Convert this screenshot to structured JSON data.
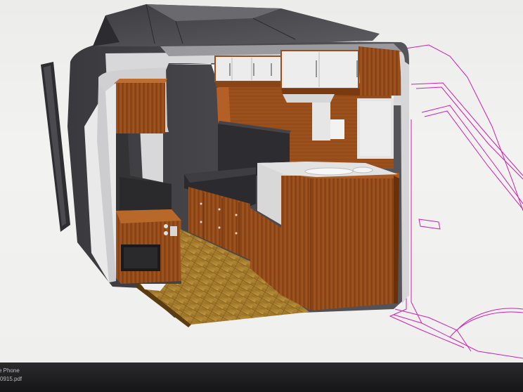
{
  "app": {
    "viewer": "3D camper van interior model"
  },
  "taskbar": {
    "file_item": {
      "line1": "e Phone",
      "line2": "0915.pdf"
    }
  },
  "colors": {
    "wood": "#9a4e1c",
    "roof_shell": "#4a4a4e",
    "floor": "#a07a2c",
    "outline": "#d020b0"
  }
}
